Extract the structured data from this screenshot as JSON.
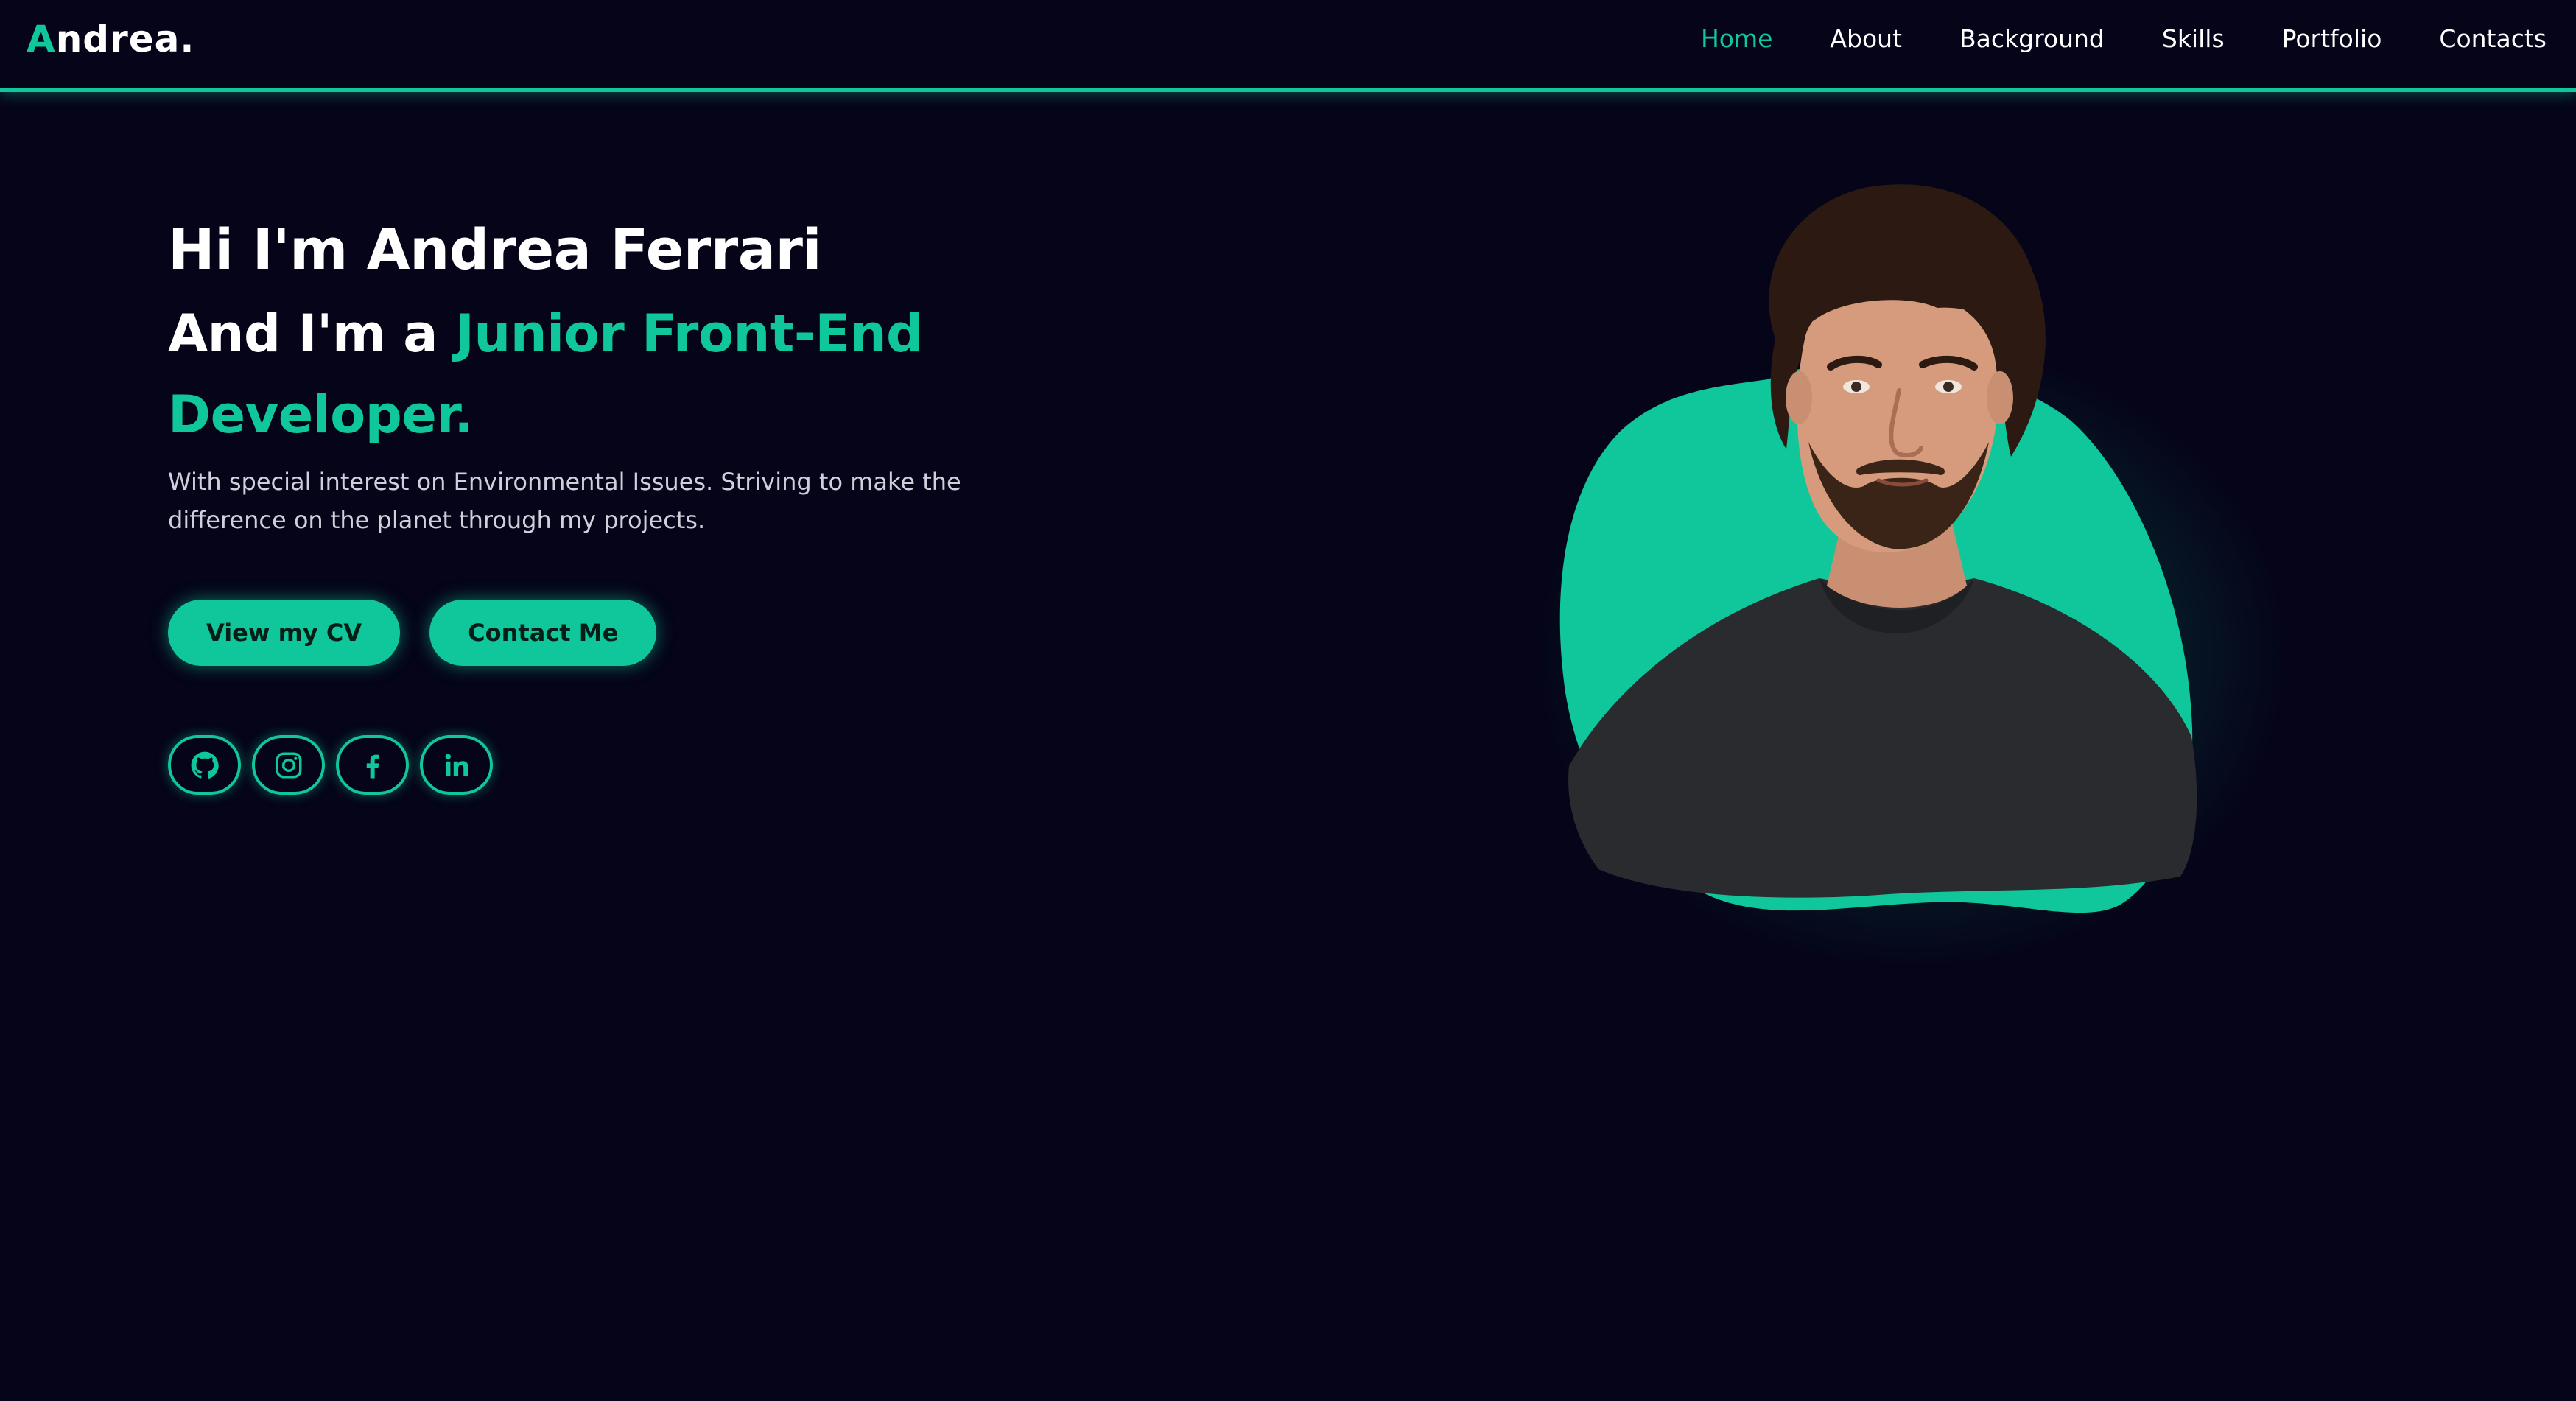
{
  "header": {
    "logo_first": "A",
    "logo_rest": "ndrea.",
    "nav": [
      {
        "label": "Home",
        "active": true
      },
      {
        "label": "About",
        "active": false
      },
      {
        "label": "Background",
        "active": false
      },
      {
        "label": "Skills",
        "active": false
      },
      {
        "label": "Portfolio",
        "active": false
      },
      {
        "label": "Contacts",
        "active": false
      }
    ]
  },
  "hero": {
    "greeting": "Hi I'm Andrea Ferrari",
    "role_prefix": "And I'm a ",
    "role": "Junior Front-End Developer.",
    "description": "With special interest on Environmental Issues. Striving to make the difference on the planet through my projects.",
    "buttons": {
      "cv": "View my CV",
      "contact": "Contact Me"
    },
    "social": [
      "github-icon",
      "instagram-icon",
      "facebook-icon",
      "linkedin-icon"
    ]
  },
  "colors": {
    "accent": "#0fc79a",
    "background": "#050418",
    "text": "#ffffff",
    "muted_text": "#cfd0db"
  }
}
